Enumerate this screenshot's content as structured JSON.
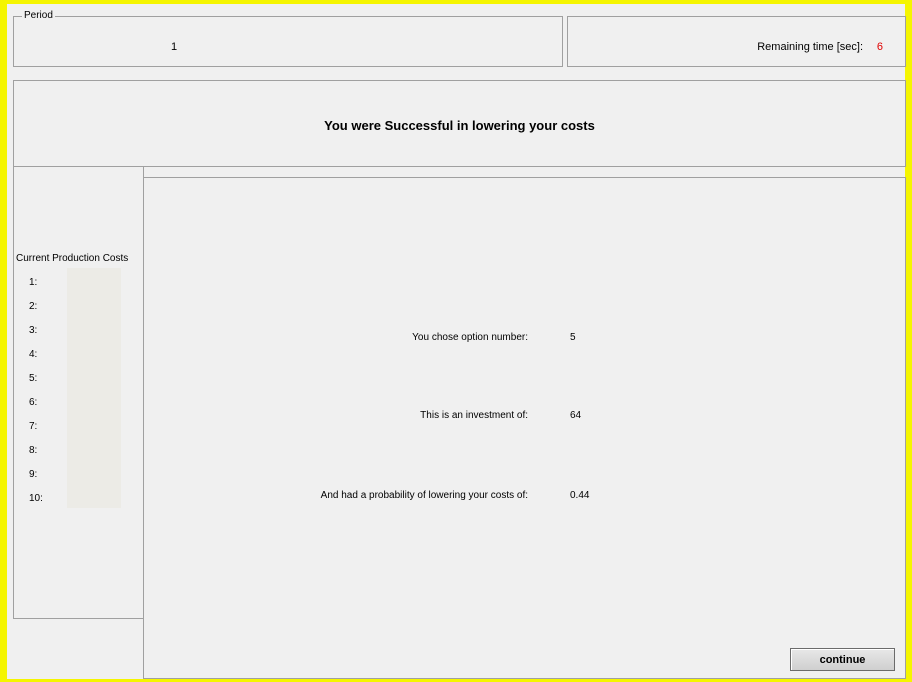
{
  "period": {
    "legend": "Period",
    "value": "1"
  },
  "timer": {
    "label": "Remaining time [sec]:",
    "value": "6"
  },
  "result": {
    "headline": "You were Successful in lowering your costs"
  },
  "costs": {
    "title": "Current Production Costs",
    "rows": [
      "1:",
      "2:",
      "3:",
      "4:",
      "5:",
      "6:",
      "7:",
      "8:",
      "9:",
      "10:"
    ]
  },
  "details": {
    "option_label": "You chose option number:",
    "option_value": "5",
    "investment_label": "This is an investment of:",
    "investment_value": "64",
    "probability_label": "And had a probability of lowering your costs of:",
    "probability_value": "0.44"
  },
  "buttons": {
    "continue_label": "continue"
  },
  "colors": {
    "frame": "#f5f500",
    "timer_value": "#e00000",
    "cost_field": "#ecebe6"
  }
}
